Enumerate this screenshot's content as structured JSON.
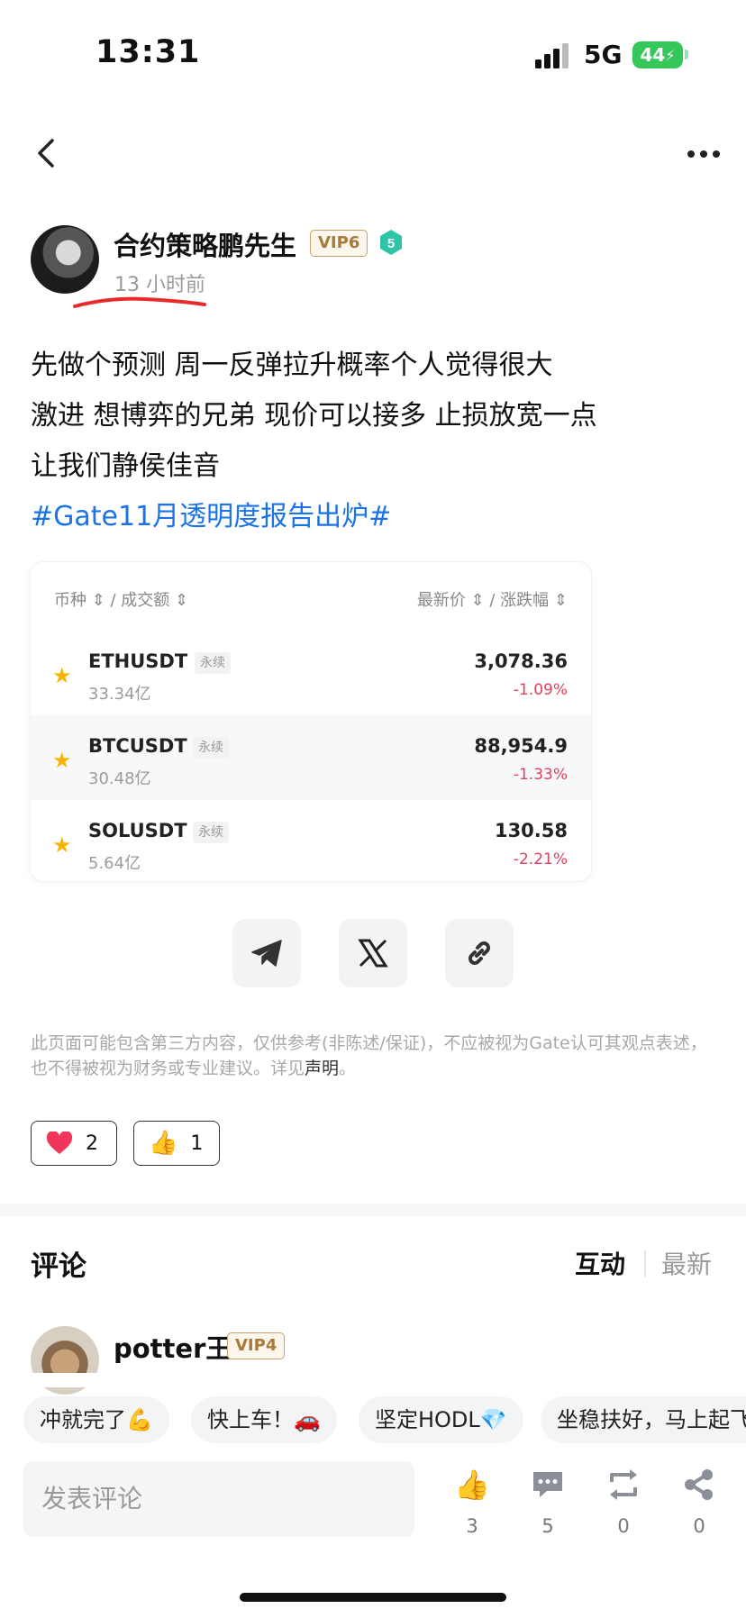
{
  "status_bar": {
    "time": "13:31",
    "network": "5G",
    "battery": "44"
  },
  "post": {
    "author": "合约策略鹏先生",
    "vip": "VIP6",
    "level": "5",
    "time_ago": "13 小时前",
    "lines": [
      "先做个预测  周一反弹拉升概率个人觉得很大",
      "激进 想博弈的兄弟 现价可以接多 止损放宽一点",
      "让我们静侯佳音"
    ],
    "hashtag": "#Gate11月透明度报告出炉#"
  },
  "market": {
    "header_left": "币种 ⇕ / 成交额 ⇕",
    "header_right": "最新价 ⇕ / 涨跌幅 ⇕",
    "rows": [
      {
        "symbol": "ETHUSDT",
        "tag": "永续",
        "volume": "33.34亿",
        "price": "3,078.36",
        "change": "-1.09%"
      },
      {
        "symbol": "BTCUSDT",
        "tag": "永续",
        "volume": "30.48亿",
        "price": "88,954.9",
        "change": "-1.33%"
      },
      {
        "symbol": "SOLUSDT",
        "tag": "永续",
        "volume": "5.64亿",
        "price": "130.58",
        "change": "-2.21%"
      }
    ]
  },
  "disclaimer": {
    "text": "此页面可能包含第三方内容，仅供参考(非陈述/保证)，不应被视为Gate认可其观点表述，也不得被视为财务或专业建议。详见",
    "link": "声明",
    "end": "。"
  },
  "reactions": [
    {
      "icon": "heart-icon",
      "count": "2"
    },
    {
      "icon": "thumbs-up-icon",
      "count": "1"
    }
  ],
  "comments": {
    "title": "评论",
    "sort_active": "互动",
    "sort_other": "最新",
    "first": {
      "name": "potter王",
      "vip": "VIP4"
    }
  },
  "quick_replies": [
    "冲就完了💪",
    "快上车！🚗",
    "坚定HODL💎",
    "坐稳扶好，马上起飞"
  ],
  "bottom": {
    "placeholder": "发表评论",
    "likes": "3",
    "comments": "5",
    "reposts": "0",
    "shares": "0"
  },
  "colors": {
    "accent": "#1a73e8",
    "down": "#e0405a",
    "star": "#f7b500",
    "vip_gold": "#a77a3b"
  }
}
